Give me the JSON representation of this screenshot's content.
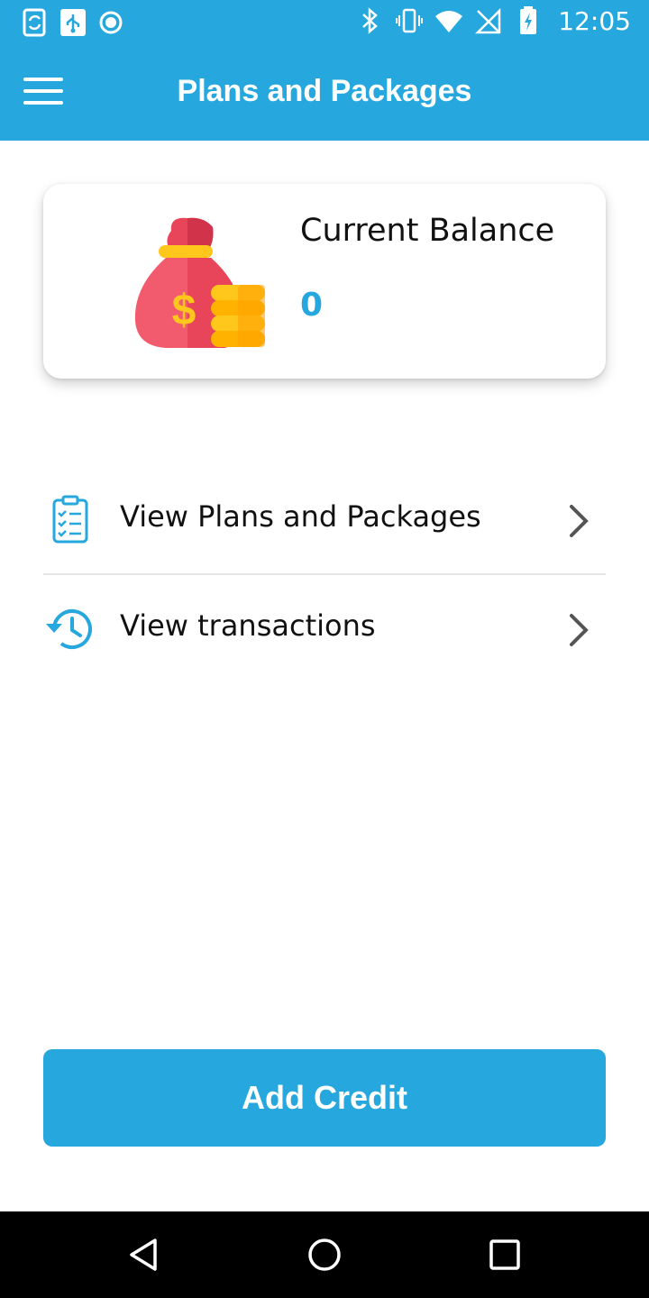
{
  "status_bar": {
    "time": "12:05",
    "left_icons": [
      "sync-icon",
      "usb-icon",
      "record-icon"
    ],
    "right_icons": [
      "bluetooth-icon",
      "vibrate-icon",
      "wifi-icon",
      "no-sim-icon",
      "battery-charging-icon"
    ]
  },
  "app_bar": {
    "title": "Plans and Packages",
    "menu_icon": "hamburger-menu-icon",
    "color": "#26a8df"
  },
  "balance": {
    "label": "Current Balance",
    "value": "0",
    "icon": "money-bag-coins-icon"
  },
  "menu_items": [
    {
      "label": "View Plans and Packages",
      "icon": "clipboard-checklist-icon",
      "chevron": "chevron-right-icon"
    },
    {
      "label": "View transactions",
      "icon": "history-clock-icon",
      "chevron": "chevron-right-icon"
    }
  ],
  "actions": {
    "add_credit_label": "Add Credit"
  },
  "nav_bar": {
    "buttons": [
      "back-triangle-icon",
      "home-circle-icon",
      "recents-square-icon"
    ]
  },
  "colors": {
    "accent": "#26a8df",
    "bag": "#e8445a",
    "coins": "#ffb300"
  }
}
